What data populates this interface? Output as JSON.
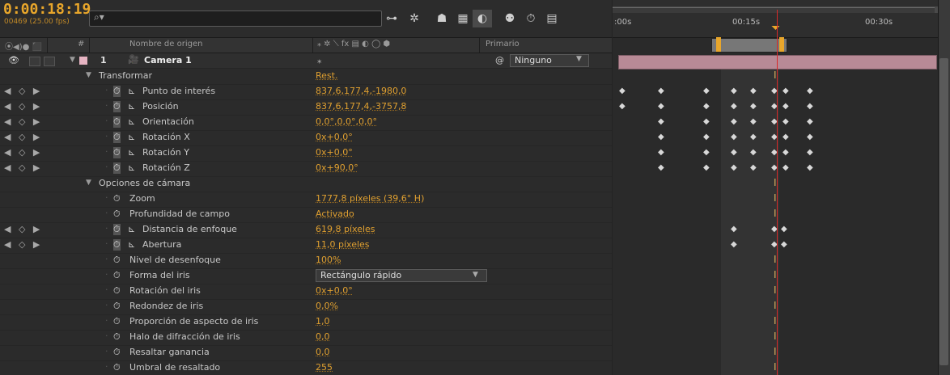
{
  "header": {
    "timecode": "0:00:18:19",
    "fps_label": "00469 (25.00 fps)",
    "search_icon": "search-icon"
  },
  "columns": {
    "number": "#",
    "source_name": "Nombre de origen",
    "parent": "Primario"
  },
  "layer": {
    "index": "1",
    "name": "Camera 1",
    "parent_value": "Ninguno"
  },
  "rows": [
    {
      "label": "Transformar",
      "value": "Rest.",
      "kind": "group"
    },
    {
      "label": "Punto de interés",
      "value": "837,6,177,4,-1980,0",
      "kind": "prop"
    },
    {
      "label": "Posición",
      "value": "837,6,177,4,-3757,8",
      "kind": "prop"
    },
    {
      "label": "Orientación",
      "value": "0,0°,0,0°,0,0°",
      "kind": "prop"
    },
    {
      "label": "Rotación X",
      "value": "0x+0,0°",
      "kind": "prop"
    },
    {
      "label": "Rotación Y",
      "value": "0x+0,0°",
      "kind": "prop"
    },
    {
      "label": "Rotación Z",
      "value": "0x+90,0°",
      "kind": "prop"
    },
    {
      "label": "Opciones de cámara",
      "value": "",
      "kind": "group"
    },
    {
      "label": "Zoom",
      "value": "1777,8 píxeles (39,6° H)",
      "kind": "prop"
    },
    {
      "label": "Profundidad de campo",
      "value": "Activado",
      "kind": "prop"
    },
    {
      "label": "Distancia de enfoque",
      "value": "619,8 píxeles",
      "kind": "prop"
    },
    {
      "label": "Abertura",
      "value": "11,0 píxeles",
      "kind": "prop"
    },
    {
      "label": "Nivel de desenfoque",
      "value": "100%",
      "kind": "prop"
    },
    {
      "label": "Forma del iris",
      "value": "Rectángulo rápido",
      "kind": "dropdown"
    },
    {
      "label": "Rotación del iris",
      "value": "0x+0,0°",
      "kind": "prop"
    },
    {
      "label": "Redondez de iris",
      "value": "0,0%",
      "kind": "prop"
    },
    {
      "label": "Proporción de aspecto de iris",
      "value": "1,0",
      "kind": "prop"
    },
    {
      "label": "Halo de difracción de iris",
      "value": "0,0",
      "kind": "prop"
    },
    {
      "label": "Resaltar ganancia",
      "value": "0,0",
      "kind": "prop"
    },
    {
      "label": "Umbral de resaltado",
      "value": "255",
      "kind": "prop"
    }
  ],
  "timeline": {
    "ticks": [
      ":00s",
      "00:15s",
      "00:30s"
    ]
  },
  "colors": {
    "timecode": "#e8a62b",
    "value": "#e0a030",
    "layer_bar": "#b88a96",
    "playhead": "#d72a2a"
  }
}
